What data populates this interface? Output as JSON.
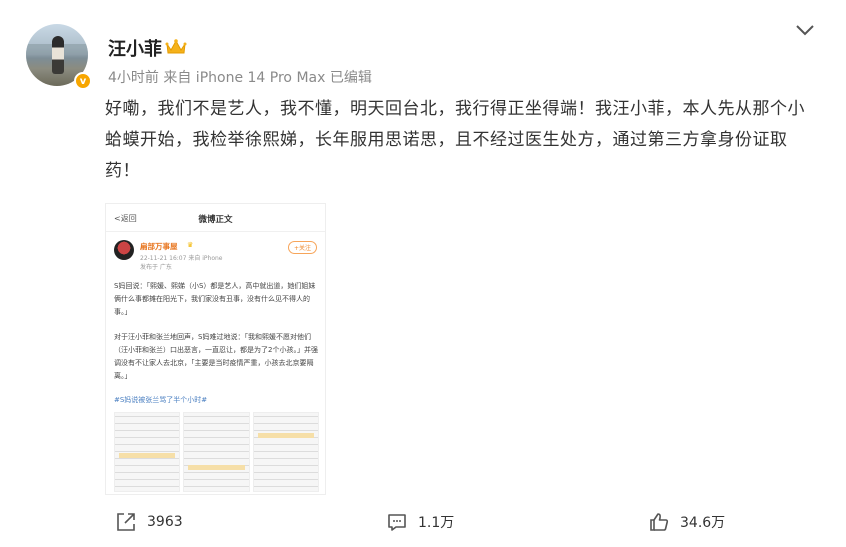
{
  "post": {
    "username": "汪小菲",
    "meta": "4小时前 来自 iPhone 14 Pro Max 已编辑",
    "verified_badge": "v",
    "text": "好嘞，我们不是艺人，我不懂，明天回台北，我行得正坐得端！我汪小菲，本人先从那个小蛤蟆开始，我检举徐熙娣，长年服用思诺思，且不经过医生处方，通过第三方拿身份证取药！"
  },
  "embed": {
    "back": "<返回",
    "title": "微博正文",
    "author": "扁部万事屋",
    "time": "22-11-21 16:07 来自 iPhone",
    "location": "发布于 广东",
    "follow": "+关注",
    "paragraph1": "S妈回说：「熙媛、熙娣（小S）都是艺人，高中就出道，她们姐妹俩什么事都摊在阳光下，我们家没有丑事，没有什么见不得人的事。」",
    "paragraph2": "对于汪小菲和张兰地回声，S妈难过地说：「我和熙媛不愿对他们（汪小菲和张兰）口出恶言，一直忍让，都是为了2个小孩。」并强调没有不让家人去北京，「主要是当时疫情严重，小孩去北京要隔离。」",
    "hashtag": "#S妈说被张兰骂了半个小时#"
  },
  "actions": {
    "share_count": "3963",
    "comment_count": "1.1万",
    "like_count": "34.6万"
  },
  "colors": {
    "badge": "#f7a600",
    "embed_name": "#e87722",
    "hashtag": "#4a7fc1"
  },
  "icons": [
    "crown-icon",
    "chevron-down-icon",
    "share-icon",
    "comment-icon",
    "like-icon"
  ]
}
